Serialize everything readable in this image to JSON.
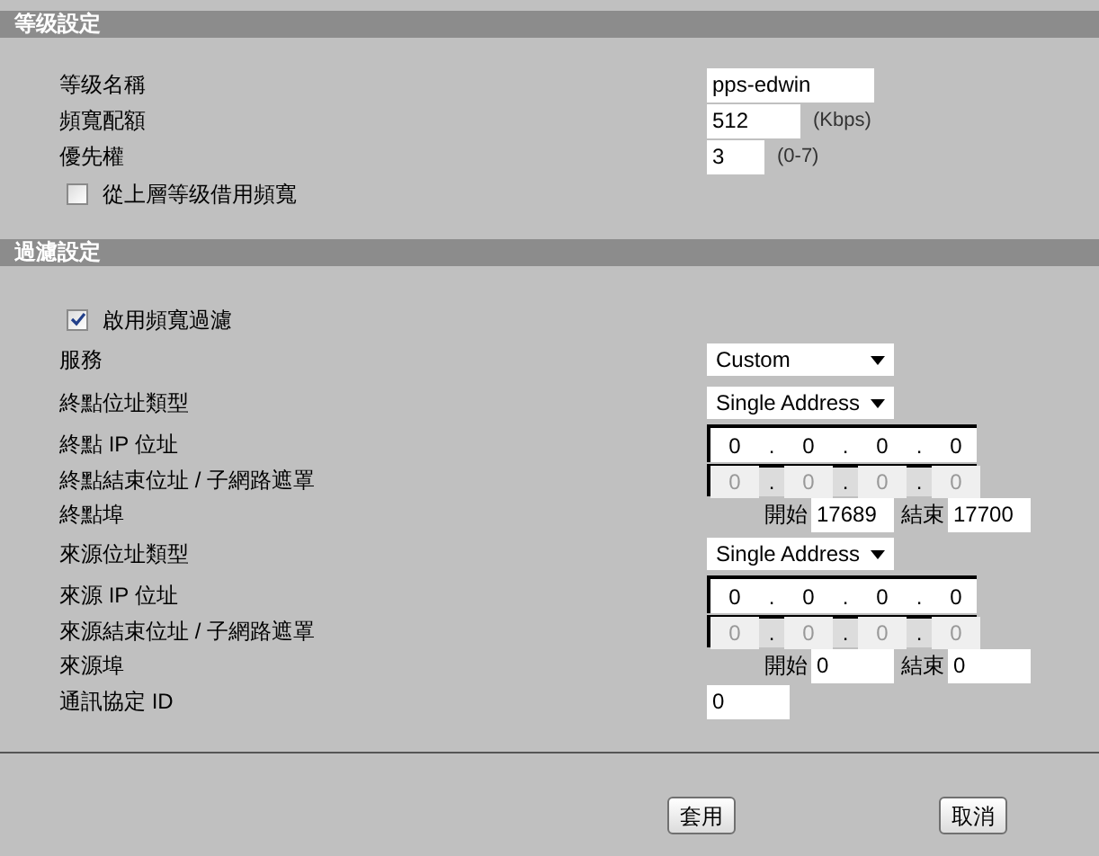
{
  "sections": [
    {
      "title": "等级設定",
      "rows": [
        {
          "kind": "text",
          "label": "等级名稱",
          "value": "pps-edwin"
        },
        {
          "kind": "text",
          "label": "頻寬配額",
          "value": "512",
          "unit": "(Kbps)"
        },
        {
          "kind": "text",
          "label": "優先權",
          "value": "3",
          "unit": "(0-7)"
        },
        {
          "kind": "checkbox",
          "label": "從上層等级借用頻寬",
          "checked": false
        }
      ]
    },
    {
      "title": "過濾設定",
      "rows": [
        {
          "kind": "checkbox",
          "label": "啟用頻寬過濾",
          "checked": true
        },
        {
          "kind": "select",
          "label": "服務",
          "value": "Custom"
        },
        {
          "kind": "select",
          "label": "終點位址類型",
          "value": "Single Address"
        },
        {
          "kind": "ip",
          "label": "終點 IP 位址",
          "octets": [
            "0",
            "0",
            "0",
            "0"
          ],
          "separators": [
            ".",
            ".",
            "."
          ],
          "disabled": false
        },
        {
          "kind": "ip",
          "label": "終點結束位址 / 子網路遮罩",
          "octets": [
            "0",
            "0",
            "0",
            "0"
          ],
          "separators": [
            ".",
            ".",
            "."
          ],
          "disabled": true
        },
        {
          "kind": "range",
          "label": "終點埠",
          "start_label": "開始",
          "start": "17689",
          "end_label": "結束",
          "end": "17700"
        },
        {
          "kind": "select",
          "label": "來源位址類型",
          "value": "Single Address"
        },
        {
          "kind": "ip",
          "label": "來源 IP 位址",
          "octets": [
            "0",
            "0",
            "0",
            "0"
          ],
          "separators": [
            ".",
            ".",
            "."
          ],
          "disabled": false
        },
        {
          "kind": "ip",
          "label": "來源結束位址 / 子網路遮罩",
          "octets": [
            "0",
            "0",
            "0",
            "0"
          ],
          "separators": [
            ".",
            ".",
            "."
          ],
          "disabled": true
        },
        {
          "kind": "range",
          "label": "來源埠",
          "start_label": "開始",
          "start": "0",
          "end_label": "結束",
          "end": "0"
        },
        {
          "kind": "text",
          "label": "通訊協定 ID",
          "value": "0"
        }
      ]
    }
  ],
  "buttons": [
    {
      "label": "套用"
    },
    {
      "label": "取消"
    }
  ]
}
